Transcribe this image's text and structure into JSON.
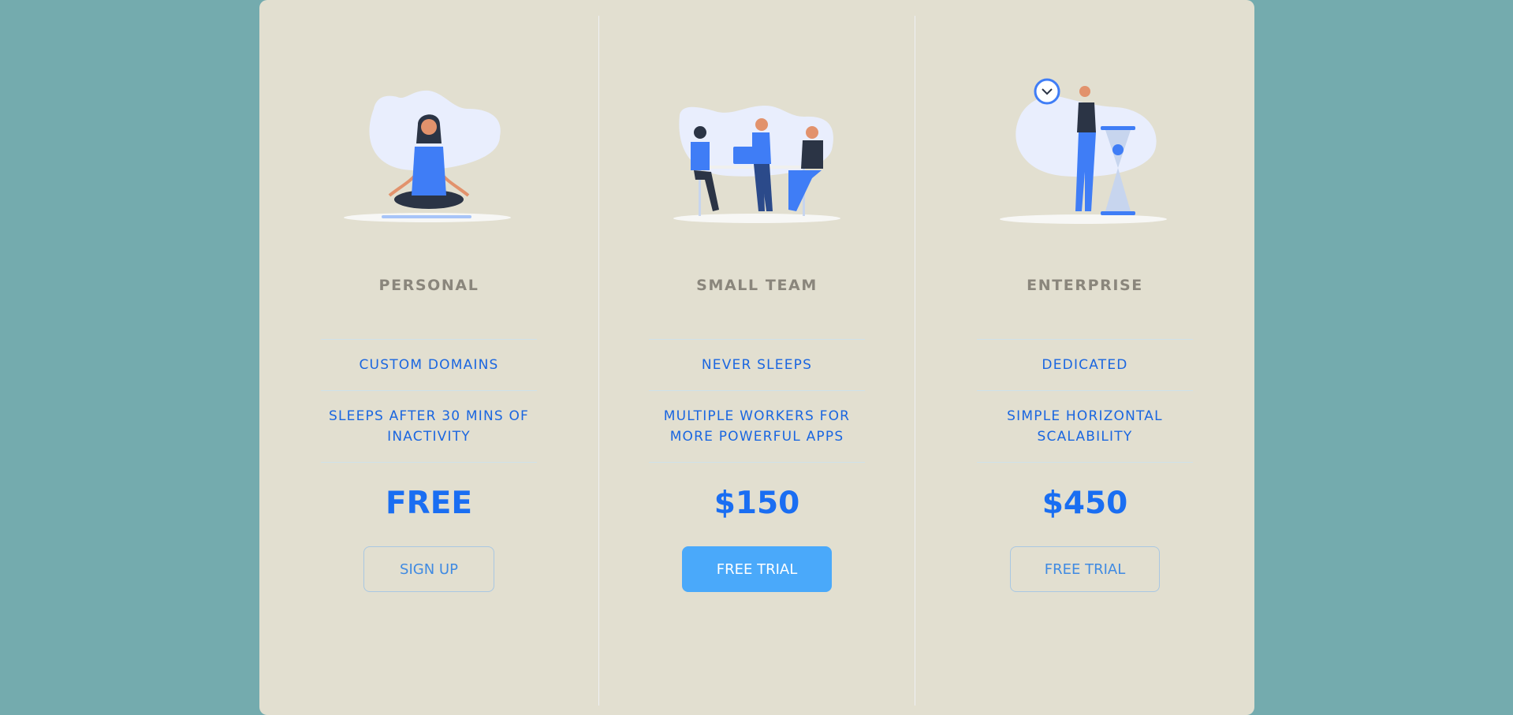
{
  "plans": [
    {
      "name": "PERSONAL",
      "features": [
        "CUSTOM DOMAINS",
        "SLEEPS AFTER 30 MINS OF INACTIVITY"
      ],
      "price": "FREE",
      "cta": "SIGN UP",
      "illustration": "meditating-person-icon"
    },
    {
      "name": "SMALL TEAM",
      "features": [
        "NEVER SLEEPS",
        "MULTIPLE WORKERS FOR MORE POWERFUL APPS"
      ],
      "price": "$150",
      "cta": "FREE TRIAL",
      "illustration": "team-meeting-icon"
    },
    {
      "name": "ENTERPRISE",
      "features": [
        "DEDICATED",
        "SIMPLE HORIZONTAL SCALABILITY"
      ],
      "price": "$450",
      "cta": "FREE TRIAL",
      "illustration": "hourglass-clock-person-icon"
    }
  ],
  "colors": {
    "background": "#74abae",
    "card": "#e2dfd0",
    "accent": "#1a6ef2",
    "button_filled": "#4aa9fa",
    "muted_text": "#8a867c"
  }
}
